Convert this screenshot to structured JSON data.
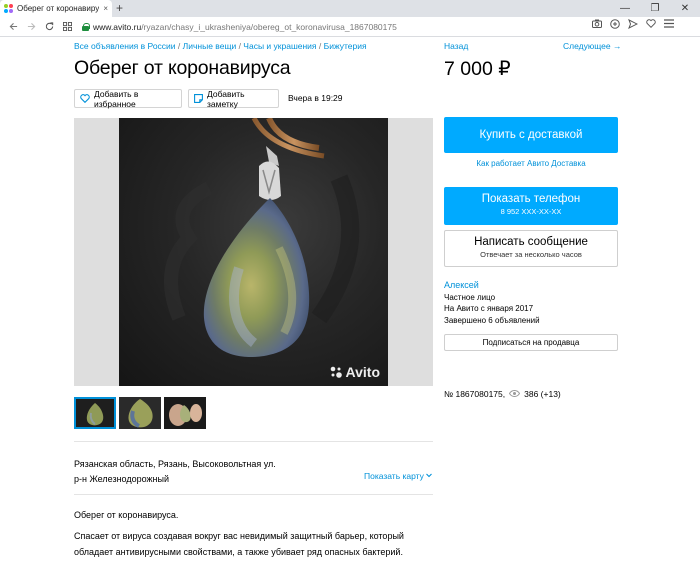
{
  "browser": {
    "tab_title": "Оберег от коронавируса",
    "tab_close": "×",
    "new_tab": "+",
    "url_host": "www.avito.ru",
    "url_path": "/ryazan/chasy_i_ukrasheniya/obereg_ot_koronavirusa_1867080175",
    "window_controls": {
      "minimize": "—",
      "restore": "❐",
      "close": "✕"
    }
  },
  "breadcrumb": [
    "Все объявления в России",
    "Личные вещи",
    "Часы и украшения",
    "Бижутерия"
  ],
  "breadcrumb_separator": " / ",
  "nav": {
    "back": "Назад",
    "next": "Следующее →"
  },
  "listing": {
    "title": "Оберег от коронавируса",
    "price": "7 000 ₽",
    "favorite_label": "Добавить в избранное",
    "note_label": "Добавить заметку",
    "posted": "Вчера в 19:29",
    "watermark": "Avito",
    "thumbnail_count": 3,
    "address_line1": "Рязанская область, Рязань, Высоковольтная ул.",
    "address_line2": "р-н Железнодорожный",
    "show_map": "Показать карту",
    "description_title": "Оберег от коронавируса.",
    "description_body": "Спасает от вируса создавая вокруг вас невидимый защитный барьер, который обладает антивирусными свойствами, а также убивает ряд опасных бактерий."
  },
  "sidebar": {
    "buy_label": "Купить с доставкой",
    "delivery_link": "Как работает Авито Доставка",
    "phone_label": "Показать телефон",
    "phone_number": "8 952 XXX-XX-XX",
    "message_label": "Написать сообщение",
    "message_sub": "Отвечает за несколько часов",
    "seller_name": "Алексей",
    "seller_type": "Частное лицо",
    "seller_since": "На Авито с января 2017",
    "seller_completed": "Завершено 6 объявлений",
    "subscribe_label": "Подписаться на продавца",
    "ad_number": "№ 1867080175,",
    "views": "386 (+13)"
  },
  "colors": {
    "accent": "#00aaff",
    "link": "#0091d9",
    "secure": "#1e8e3e"
  },
  "icons": [
    "avito-favicon",
    "back-arrow-icon",
    "forward-arrow-icon",
    "reload-icon",
    "apps-icon",
    "lock-icon",
    "camera-icon",
    "extension-icon",
    "send-icon",
    "heart-icon",
    "menu-icon",
    "note-icon",
    "eye-icon",
    "chevron-down-icon"
  ]
}
